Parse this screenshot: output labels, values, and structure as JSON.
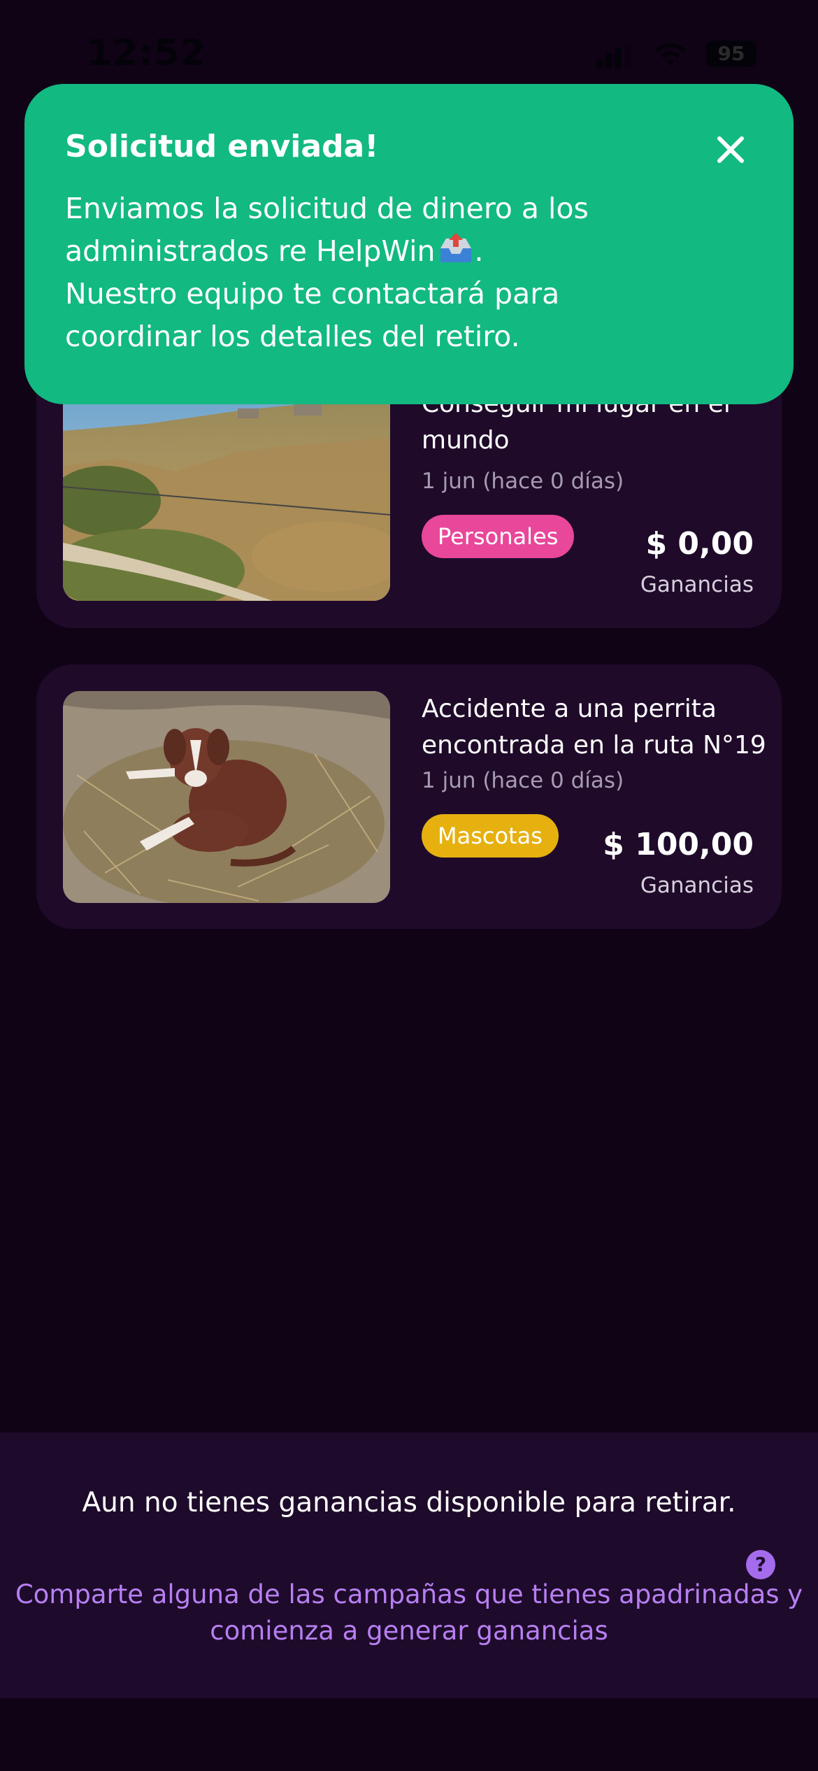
{
  "status_bar": {
    "time": "12:52",
    "battery": "95"
  },
  "toast": {
    "title": "Solicitud enviada!",
    "body_lines": [
      "Enviamos la solicitud de dinero a los",
      "administrados re HelpWin",
      ".",
      "Nuestro equipo te contactará para",
      "coordinar los detalles del retiro."
    ],
    "close_icon": "close-icon",
    "inbox_icon": "outbox-tray-icon"
  },
  "campaigns": [
    {
      "title": "Conseguir mi lugar en el mundo",
      "date": "1 jun (hace 0 días)",
      "tag": "Personales",
      "tag_color": "#e9479a",
      "amount": "$ 0,00",
      "amount_label": "Ganancias"
    },
    {
      "title": "Accidente a una perrita encontrada en la ruta N°19",
      "date": "1 jun (hace 0 días)",
      "tag": "Mascotas",
      "tag_color": "#e6b10f",
      "amount": "$ 100,00",
      "amount_label": "Ganancias"
    }
  ],
  "footer": {
    "message": "Aun no tienes ganancias disponible para retirar.",
    "help_icon": "?",
    "hint": "Comparte alguna de las campañas que tienes apadrinadas y comienza a generar ganancias"
  },
  "colors": {
    "background": "#100316",
    "card": "#1f0a2a",
    "toast": "#12b981",
    "accent_purple": "#b77ff2"
  }
}
